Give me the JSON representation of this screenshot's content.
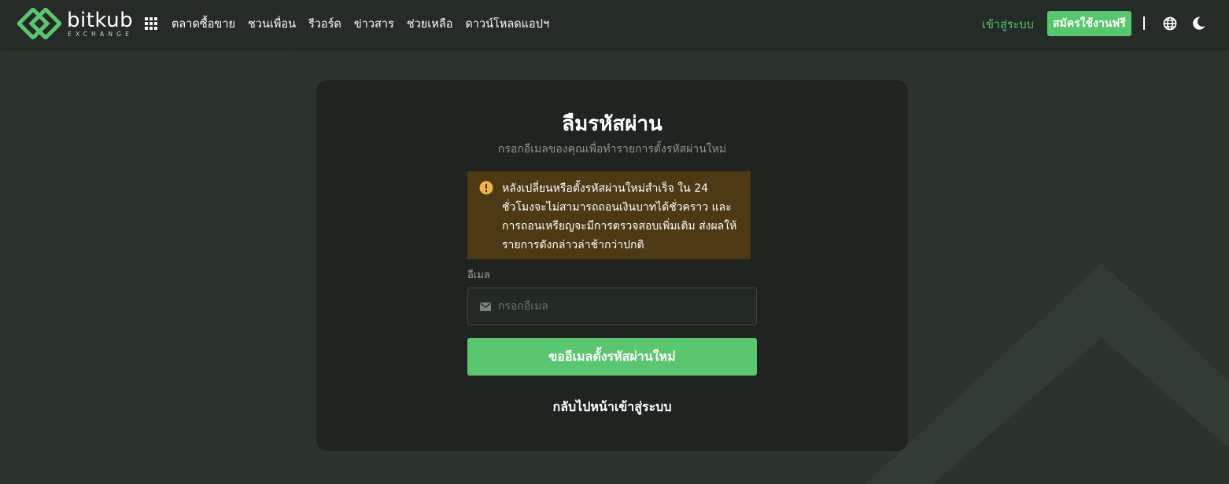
{
  "brand": {
    "name": "bitkub",
    "sub": "EXCHANGE",
    "color": "#5ac66f"
  },
  "nav": {
    "apps_icon": "grid-icon",
    "links": [
      "ตลาดซื้อขาย",
      "ชวนเพื่อน",
      "รีวอร์ด",
      "ข่าวสาร",
      "ช่วยเหลือ",
      "ดาวน์โหลดแอปฯ"
    ],
    "login": "เข้าสู่ระบบ",
    "signup": "สมัครใช้งานฟรี",
    "language_icon": "globe-icon",
    "theme_icon": "moon-icon"
  },
  "form": {
    "title": "ลืมรหัสผ่าน",
    "subtitle": "กรอกอีเมลของคุณเพื่อทำรายการตั้งรหัสผ่านใหม่",
    "alert": {
      "icon": "exclamation-circle-icon",
      "text": "หลังเปลี่ยนหรือตั้งรหัสผ่านใหม่สำเร็จ ใน 24 ชั่วโมงจะไม่สามารถถอนเงินบาทได้ชั่วคราว และการถอนเหรียญจะมีการตรวจสอบเพิ่มเติม ส่งผลให้รายการดังกล่าวล่าช้ากว่าปกติ",
      "color": "#4d3a14"
    },
    "email": {
      "label": "อีเมล",
      "placeholder": "กรอกอีเมล",
      "value": "",
      "icon": "envelope-icon"
    },
    "submit": "ขออีเมลตั้งรหัสผ่านใหม่",
    "back": "กลับไปหน้าเข้าสู่ระบบ"
  },
  "colors": {
    "accent": "#5ac670",
    "background": "#2b342e",
    "card": "#1f2420",
    "warning": "#f0b44c"
  }
}
